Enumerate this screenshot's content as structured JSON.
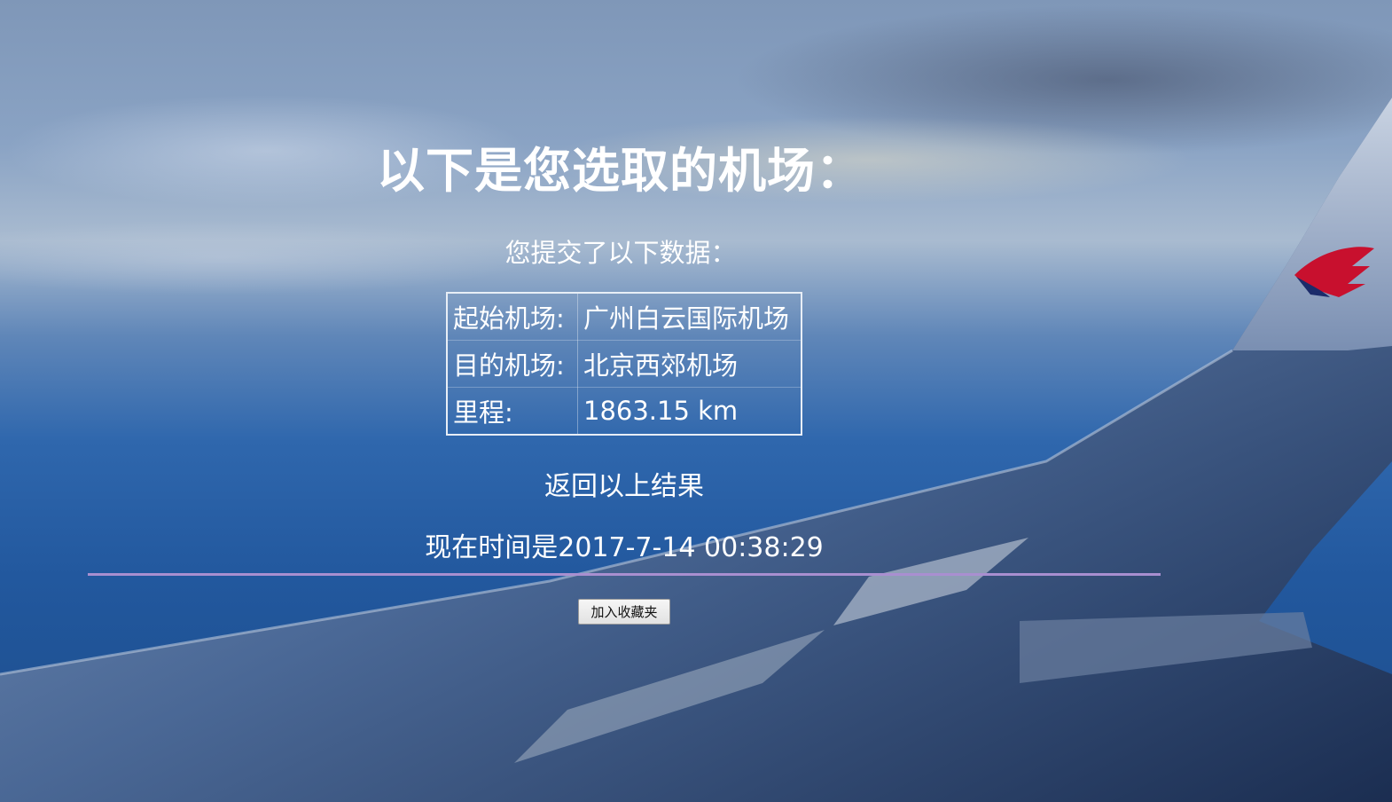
{
  "page": {
    "title": "以下是您选取的机场：",
    "subtitle": "您提交了以下数据："
  },
  "result_table": {
    "rows": [
      {
        "label": "起始机场:",
        "value": "广州白云国际机场"
      },
      {
        "label": "目的机场:",
        "value": "北京西郊机场"
      },
      {
        "label": "里程:",
        "value": "1863.15 km"
      }
    ]
  },
  "back_link": {
    "label": "返回以上结果"
  },
  "clock": {
    "text": "现在时间是2017-7-14 00:38:29"
  },
  "favorite_button": {
    "label": "加入收藏夹"
  },
  "colors": {
    "text": "#ffffff",
    "divider": "#a98fd0",
    "sky_top": "#7f97b8",
    "sky_bottom": "#1c4c8a"
  }
}
